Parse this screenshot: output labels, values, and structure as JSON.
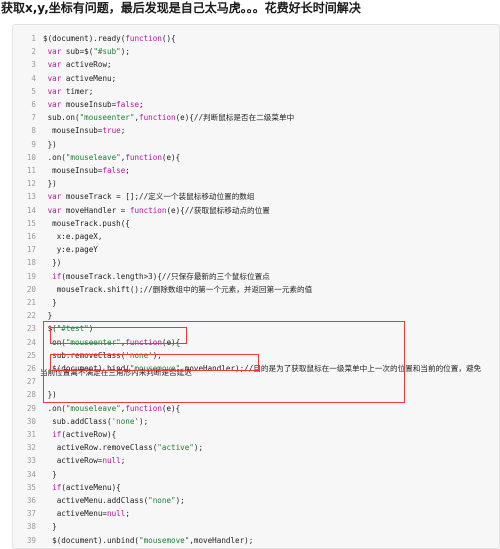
{
  "headline": "获取x,y,坐标有问题，最后发现是自己太马虎。。。花费好长时间解决",
  "code_lines": [
    {
      "n": "1",
      "t": "$(document).ready(function(){"
    },
    {
      "n": "2",
      "t": " var sub=$(\"#sub\");"
    },
    {
      "n": "3",
      "t": " var activeRow;"
    },
    {
      "n": "4",
      "t": " var activeMenu;"
    },
    {
      "n": "5",
      "t": " var timer;"
    },
    {
      "n": "6",
      "t": " var mouseInsub=false;"
    },
    {
      "n": "7",
      "t": " sub.on(\"mouseenter\",function(e){//判断鼠标是否在二级菜单中"
    },
    {
      "n": "8",
      "t": "  mouseInsub=true;"
    },
    {
      "n": "9",
      "t": " })"
    },
    {
      "n": "10",
      "t": " .on(\"mouseleave\",function(e){"
    },
    {
      "n": "11",
      "t": "  mouseInsub=false;"
    },
    {
      "n": "12",
      "t": " })"
    },
    {
      "n": "13",
      "t": " var mouseTrack = [];//定义一个装鼠标移动位置的数组"
    },
    {
      "n": "14",
      "t": " var moveHandler = function(e){//获取鼠标移动点的位置"
    },
    {
      "n": "15",
      "t": "  mouseTrack.push({"
    },
    {
      "n": "16",
      "t": "   x:e.pageX,"
    },
    {
      "n": "17",
      "t": "   y:e.pageY"
    },
    {
      "n": "18",
      "t": "  })"
    },
    {
      "n": "19",
      "t": "  if(mouseTrack.length>3){//只保存最新的三个鼠标位置点"
    },
    {
      "n": "20",
      "t": "   mouseTrack.shift();//删除数组中的第一个元素，并返回第一元素的值"
    },
    {
      "n": "21",
      "t": "  }"
    },
    {
      "n": "22",
      "t": " }"
    },
    {
      "n": "23",
      "t": " $(\"#test\")"
    },
    {
      "n": "24",
      "t": "  on(\"mouseenter\",function(e){"
    },
    {
      "n": "25",
      "t": "  sub.removeClass('none');"
    },
    {
      "n": "26",
      "t": "  $(document).bind(\"mousemove\",moveHandler);//目的是为了获取鼠标在一级菜单中上一次的位置和当前的位置，避免"
    },
    {
      "n": "27",
      "t": ""
    },
    {
      "n": "28",
      "t": " })"
    },
    {
      "n": "29",
      "t": " .on(\"mouseleave\",function(e){"
    },
    {
      "n": "30",
      "t": "  sub.addClass('none');"
    },
    {
      "n": "31",
      "t": "  if(activeRow){"
    },
    {
      "n": "32",
      "t": "   activeRow.removeClass(\"active\");"
    },
    {
      "n": "33",
      "t": "   activeRow=null;"
    },
    {
      "n": "34",
      "t": "  }"
    },
    {
      "n": "35",
      "t": "  if(activeMenu){"
    },
    {
      "n": "36",
      "t": "   activeMenu.addClass(\"none\");"
    },
    {
      "n": "37",
      "t": "   activeMenu=null;"
    },
    {
      "n": "38",
      "t": "  }"
    },
    {
      "n": "39",
      "t": "  $(document).unbind(\"mousemove\",moveHandler);"
    }
  ],
  "wrapped_line_27": "当前位置离不满足在三角形内来判断是否延迟",
  "colors": {
    "highlight_border": "#e63b3b",
    "keyword": "#b5179e",
    "string": "#1a7f37"
  }
}
